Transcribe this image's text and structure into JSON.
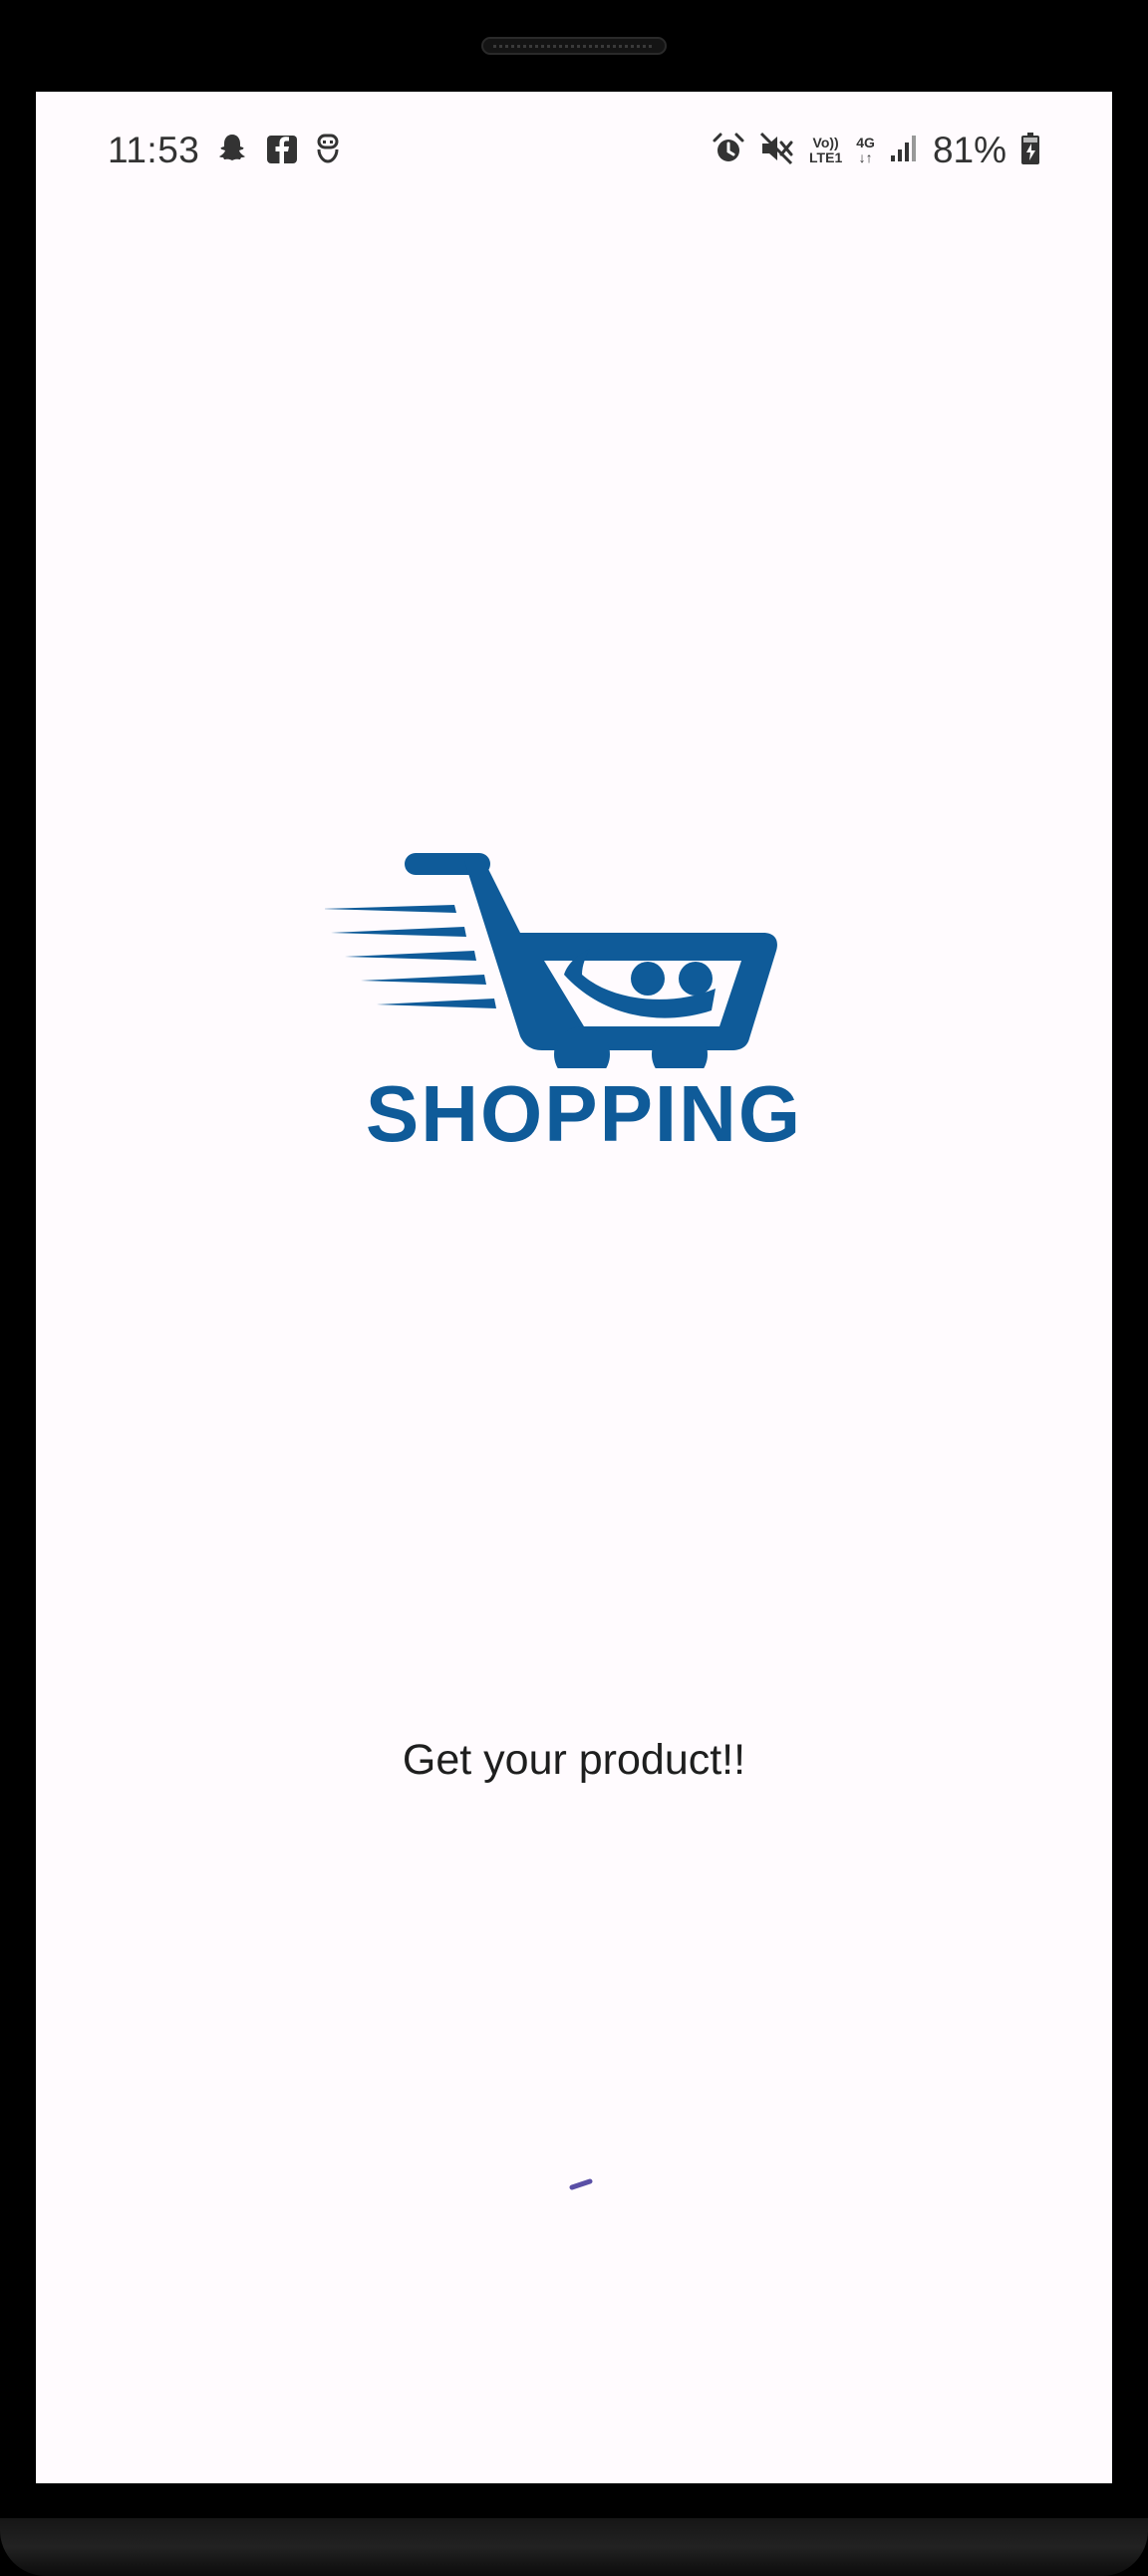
{
  "status_bar": {
    "time": "11:53",
    "left_icons": [
      "snapchat-icon",
      "facebook-icon",
      "notification-icon"
    ],
    "right_icons": [
      "alarm-icon",
      "mute-icon",
      "volte-icon",
      "4g-icon",
      "signal-icon",
      "battery-charging-icon"
    ],
    "volte_line1": "Vo))",
    "volte_line2": "LTE1",
    "net_line1": "4G",
    "net_line2": "↓↑",
    "battery_percent": "81%"
  },
  "logo": {
    "text": "SHOPPING",
    "icon": "shopping-cart-smile-icon",
    "color": "#0f5b99"
  },
  "tagline": "Get your product!!",
  "loader": {
    "icon": "loading-spinner-icon",
    "color": "#5a4fa6"
  }
}
